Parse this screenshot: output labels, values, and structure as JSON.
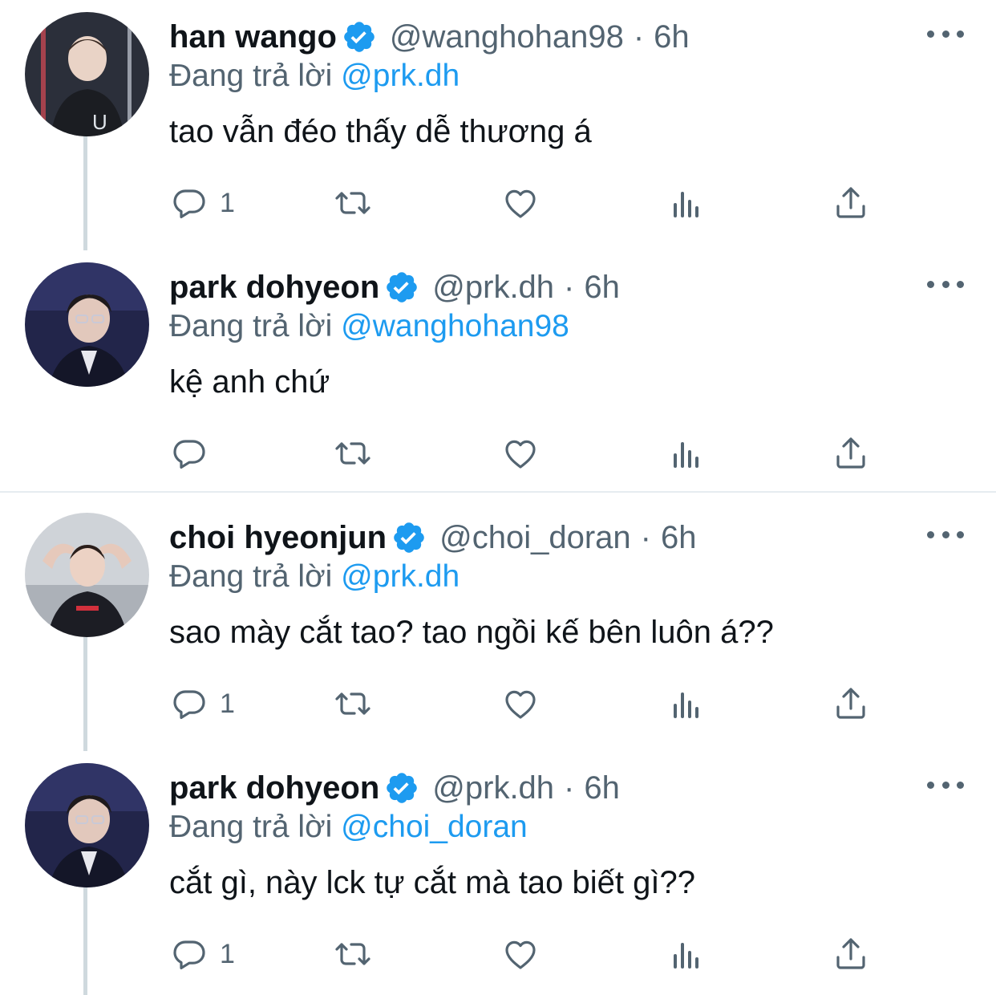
{
  "tweets": [
    {
      "display_name": "han wango",
      "handle": "@wanghohan98",
      "separator": "·",
      "time": "6h",
      "reply_prefix": "Đang trả lời",
      "reply_mention": "@prk.dh",
      "text": "tao vẫn đéo thấy dễ thương á",
      "reply_count": "1",
      "avatar": "avatar-photo"
    },
    {
      "display_name": "park dohyeon",
      "handle": "@prk.dh",
      "separator": "·",
      "time": "6h",
      "reply_prefix": "Đang trả lời",
      "reply_mention": "@wanghohan98",
      "text": "kệ anh chứ",
      "reply_count": "",
      "avatar": "avatar-photo"
    },
    {
      "display_name": "choi hyeonjun",
      "handle": "@choi_doran",
      "separator": "·",
      "time": "6h",
      "reply_prefix": "Đang trả lời",
      "reply_mention": "@prk.dh",
      "text": "sao mày cắt tao? tao ngồi kế bên luôn á??",
      "reply_count": "1",
      "avatar": "avatar-photo"
    },
    {
      "display_name": "park dohyeon",
      "handle": "@prk.dh",
      "separator": "·",
      "time": "6h",
      "reply_prefix": "Đang trả lời",
      "reply_mention": "@choi_doran",
      "text": "cắt gì, này lck tự cắt mà tao biết gì??",
      "reply_count": "1",
      "avatar": "avatar-photo"
    }
  ],
  "icons": {
    "verified": "verified-badge-icon",
    "more": "more-options-icon",
    "reply": "reply-icon",
    "retweet": "retweet-icon",
    "like": "like-icon",
    "views": "views-icon",
    "share": "share-icon"
  },
  "colors": {
    "accent": "#1d9bf0",
    "text_primary": "#0f1419",
    "text_secondary": "#536471",
    "thread_line": "#cfd9de"
  }
}
